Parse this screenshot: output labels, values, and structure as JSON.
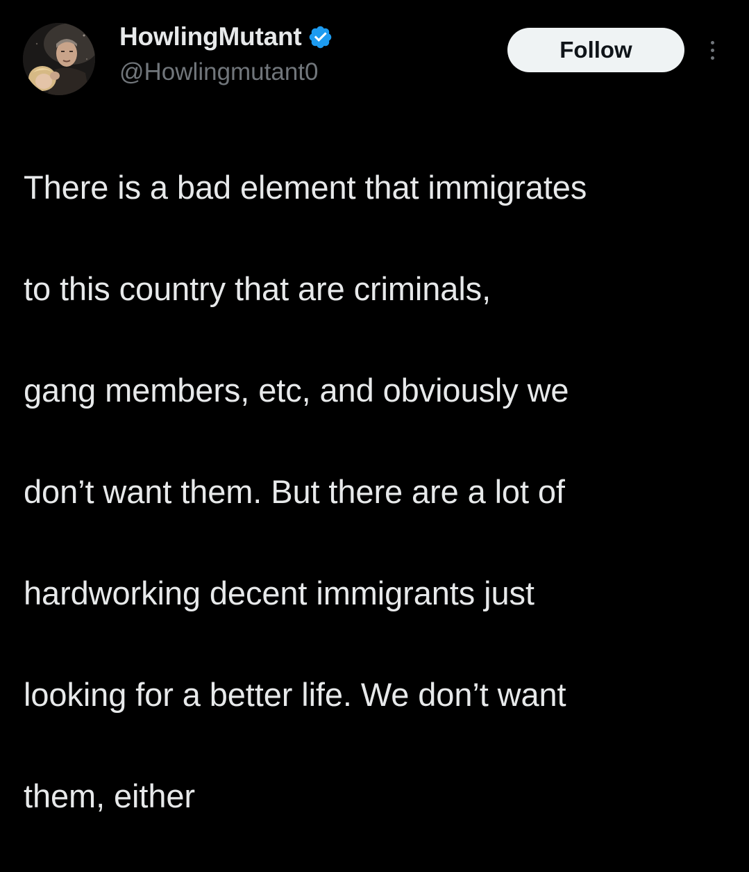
{
  "author": {
    "display_name": "HowlingMutant",
    "handle": "@Howlingmutant0",
    "verified": true,
    "avatar_icon": "profile-photo"
  },
  "actions": {
    "follow_label": "Follow",
    "more_icon": "more-options-icon"
  },
  "tweet": {
    "text_lines": [
      "There is a bad element that immigrates",
      "to this country that are criminals,",
      "gang members, etc, and obviously we",
      "don’t want them.  But there are a lot of",
      "hardworking decent immigrants just",
      "looking for a better life.  We don’t want",
      "them, either"
    ]
  },
  "colors": {
    "background": "#000000",
    "text_primary": "#e7e9ea",
    "text_secondary": "#71767b",
    "verified_blue": "#1d9bf0",
    "follow_bg": "#eff3f4",
    "follow_text": "#0f1419"
  }
}
